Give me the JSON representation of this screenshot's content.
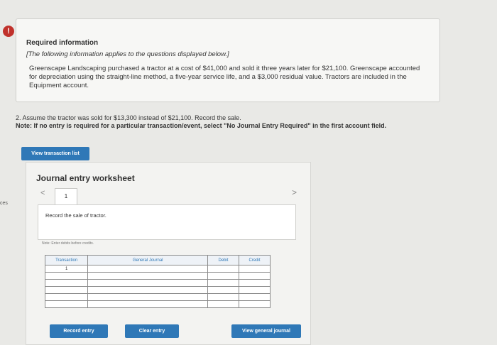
{
  "alert_mark": "!",
  "side_text": "ces",
  "info": {
    "title": "Required information",
    "subtitle": "[The following information applies to the questions displayed below.]",
    "body": "Greenscape Landscaping purchased a tractor at a cost of $41,000 and sold it three years later for $21,100. Greenscape accounted for depreciation using the straight-line method, a five-year service life, and a $3,000 residual value. Tractors are included in the Equipment account."
  },
  "question": {
    "text": "2. Assume the tractor was sold for $13,300 instead of $21,100. Record the sale.",
    "note": "Note: If no entry is required for a particular transaction/event, select \"No Journal Entry Required\" in the first account field."
  },
  "buttons": {
    "view_transaction_list": "View transaction list",
    "record_entry": "Record entry",
    "clear_entry": "Clear entry",
    "view_general_journal": "View general journal"
  },
  "worksheet": {
    "title": "Journal entry worksheet",
    "tab_label": "1",
    "prev_icon": "<",
    "next_icon": ">",
    "description": "Record the sale of tractor.",
    "note": "Note: Enter debits before credits."
  },
  "journal": {
    "headers": [
      "Transaction",
      "General Journal",
      "Debit",
      "Credit"
    ],
    "rows": [
      {
        "transaction": "1",
        "account": "",
        "debit": "",
        "credit": ""
      },
      {
        "transaction": "",
        "account": "",
        "debit": "",
        "credit": ""
      },
      {
        "transaction": "",
        "account": "",
        "debit": "",
        "credit": ""
      },
      {
        "transaction": "",
        "account": "",
        "debit": "",
        "credit": ""
      },
      {
        "transaction": "",
        "account": "",
        "debit": "",
        "credit": ""
      },
      {
        "transaction": "",
        "account": "",
        "debit": "",
        "credit": ""
      }
    ]
  },
  "colors": {
    "accent": "#2f78b7",
    "alert": "#c0312b"
  }
}
